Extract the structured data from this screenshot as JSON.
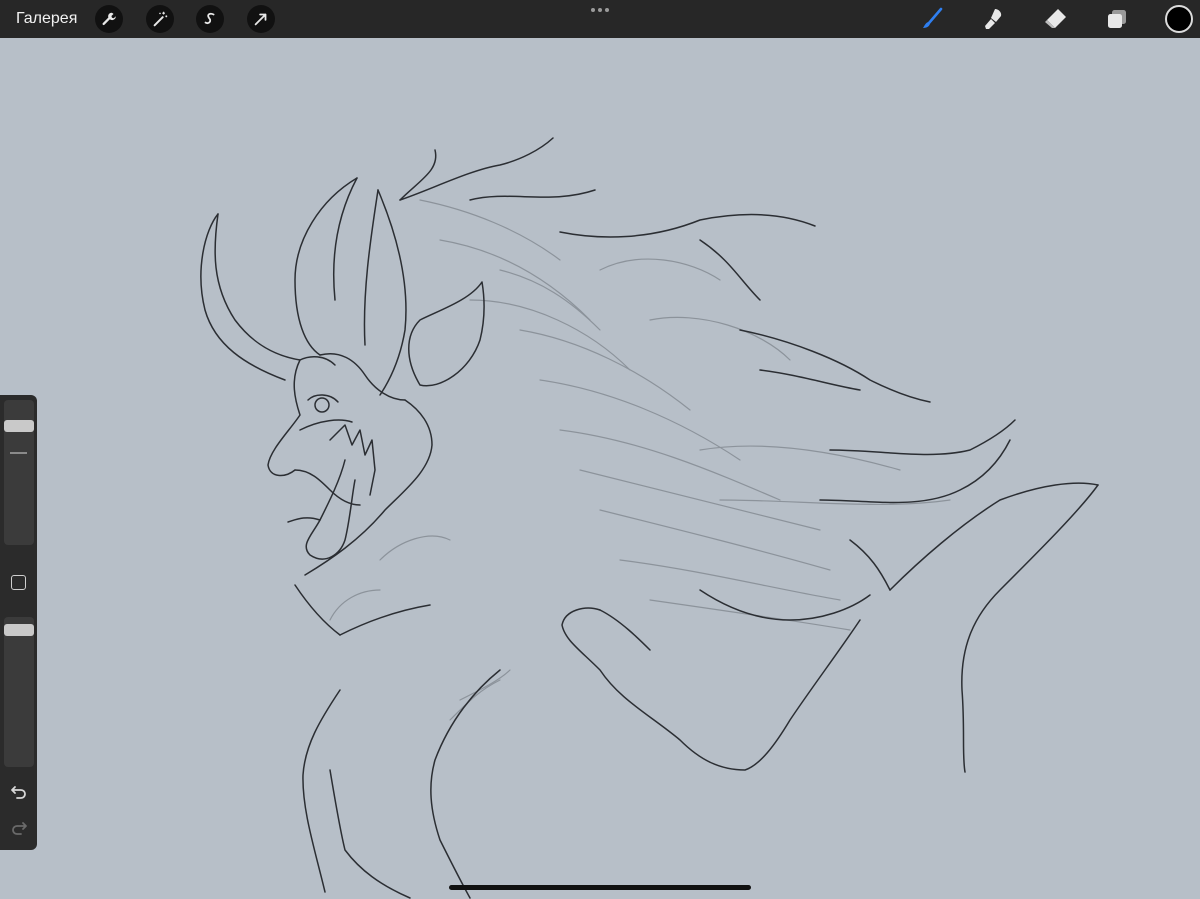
{
  "topbar": {
    "gallery_label": "Галерея",
    "left_tools": [
      {
        "icon": "wrench-icon"
      },
      {
        "icon": "magic-wand-icon"
      },
      {
        "icon": "selection-s-icon"
      },
      {
        "icon": "arrow-transform-icon"
      }
    ],
    "more_icon": "three-dots-icon",
    "right_tools": [
      {
        "icon": "brush-icon",
        "active": true
      },
      {
        "icon": "smudge-icon",
        "active": false
      },
      {
        "icon": "eraser-icon",
        "active": false
      },
      {
        "icon": "layers-icon",
        "active": false
      }
    ],
    "current_color": "#000000"
  },
  "sidebar": {
    "brush_size_level": 0.85,
    "opacity_level": 0.95,
    "modify_icon": "square-icon",
    "undo_icon": "undo-icon",
    "redo_icon": "redo-icon"
  },
  "colors": {
    "canvas_background": "#b7bfc8",
    "toolbar": "#272727",
    "active_tool": "#2f7ff0",
    "line_art": "#2b2e33"
  }
}
